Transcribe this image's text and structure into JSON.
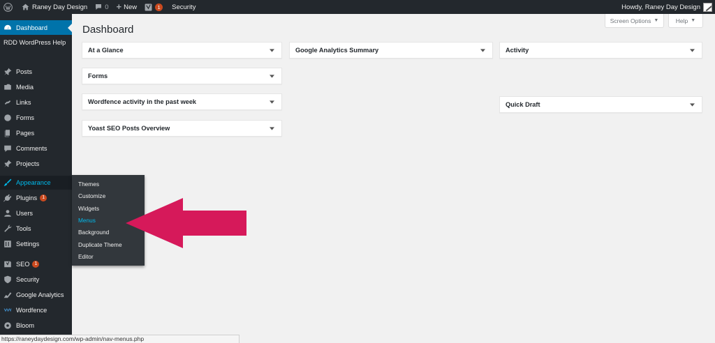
{
  "adminbar": {
    "site_name": "Raney Day Design",
    "comments_count": "0",
    "new_label": "New",
    "yoast_badge": "1",
    "security_label": "Security",
    "howdy": "Howdy, Raney Day Design"
  },
  "sidebar": {
    "dashboard": "Dashboard",
    "rdd_help": "RDD WordPress Help",
    "posts": "Posts",
    "media": "Media",
    "links": "Links",
    "forms": "Forms",
    "pages": "Pages",
    "comments": "Comments",
    "projects": "Projects",
    "appearance": "Appearance",
    "plugins": "Plugins",
    "plugins_badge": "1",
    "users": "Users",
    "tools": "Tools",
    "settings": "Settings",
    "seo": "SEO",
    "seo_badge": "1",
    "security": "Security",
    "google_analytics": "Google Analytics",
    "wordfence": "Wordfence",
    "bloom": "Bloom"
  },
  "flyout": {
    "themes": "Themes",
    "customize": "Customize",
    "widgets": "Widgets",
    "menus": "Menus",
    "background": "Background",
    "duplicate_theme": "Duplicate Theme",
    "editor": "Editor"
  },
  "main": {
    "title": "Dashboard",
    "screen_options": "Screen Options",
    "help": "Help",
    "widgets": {
      "at_a_glance": "At a Glance",
      "forms": "Forms",
      "wordfence": "Wordfence activity in the past week",
      "yoast": "Yoast SEO Posts Overview",
      "google_analytics": "Google Analytics Summary",
      "activity": "Activity",
      "quick_draft": "Quick Draft"
    }
  },
  "status_url": "https://raneydaydesign.com/wp-admin/nav-menus.php",
  "colors": {
    "admin_dark": "#23282d",
    "accent_blue": "#0073aa",
    "hover_blue": "#00b9eb",
    "badge_orange": "#ca4a1f",
    "arrow_pink": "#d6195a"
  }
}
